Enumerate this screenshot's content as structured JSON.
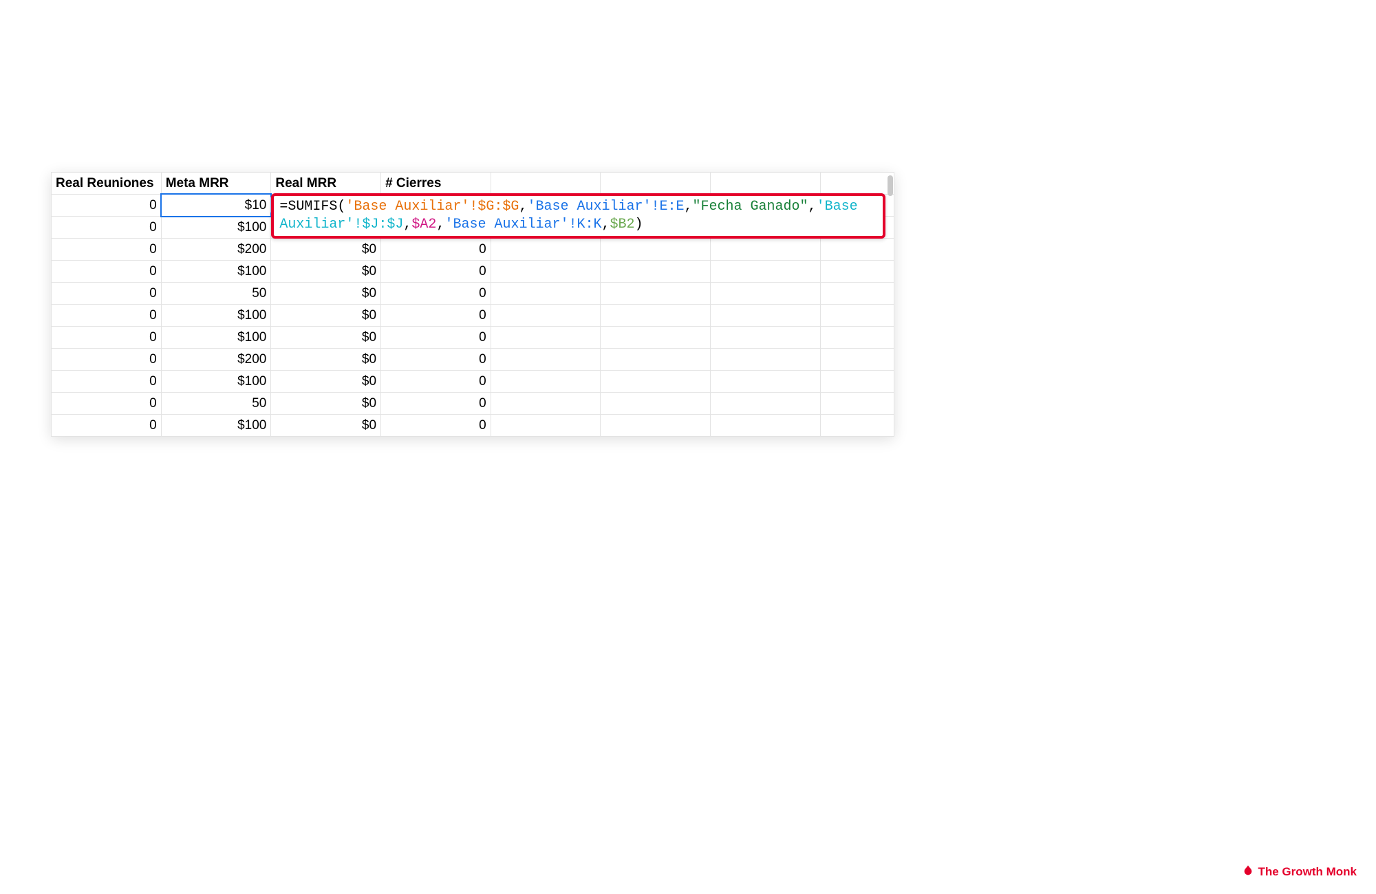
{
  "columns": {
    "c1": "Real Reuniones",
    "c2": "Meta MRR",
    "c3": "Real MRR",
    "c4": "# Cierres",
    "c5": "",
    "c6": "",
    "c7": "",
    "c8": ""
  },
  "rows": [
    {
      "real_reuniones": "0",
      "meta_mrr": "$10",
      "real_mrr": "",
      "cierres": ""
    },
    {
      "real_reuniones": "0",
      "meta_mrr": "$100",
      "real_mrr": "",
      "cierres": ""
    },
    {
      "real_reuniones": "0",
      "meta_mrr": "$200",
      "real_mrr": "$0",
      "cierres": "0"
    },
    {
      "real_reuniones": "0",
      "meta_mrr": "$100",
      "real_mrr": "$0",
      "cierres": "0"
    },
    {
      "real_reuniones": "0",
      "meta_mrr": "50",
      "real_mrr": "$0",
      "cierres": "0"
    },
    {
      "real_reuniones": "0",
      "meta_mrr": "$100",
      "real_mrr": "$0",
      "cierres": "0"
    },
    {
      "real_reuniones": "0",
      "meta_mrr": "$100",
      "real_mrr": "$0",
      "cierres": "0"
    },
    {
      "real_reuniones": "0",
      "meta_mrr": "$200",
      "real_mrr": "$0",
      "cierres": "0"
    },
    {
      "real_reuniones": "0",
      "meta_mrr": "$100",
      "real_mrr": "$0",
      "cierres": "0"
    },
    {
      "real_reuniones": "0",
      "meta_mrr": "50",
      "real_mrr": "$0",
      "cierres": "0"
    },
    {
      "real_reuniones": "0",
      "meta_mrr": "$100",
      "real_mrr": "$0",
      "cierres": "0"
    }
  ],
  "formula": {
    "help_label": "?",
    "prefix": "=SUMIFS(",
    "arg1": "'Base Auxiliar'!$G:$G",
    "sep": ",",
    "arg2": "'Base Auxiliar'!E:E",
    "arg3": "\"Fecha Ganado\"",
    "arg4": "'Base Auxiliar'!$J:$J",
    "arg5": "$A2",
    "arg6": "'Base Auxiliar'!K:K",
    "arg7": "$B2",
    "suffix": ")"
  },
  "brand": {
    "text": "The Growth Monk"
  }
}
